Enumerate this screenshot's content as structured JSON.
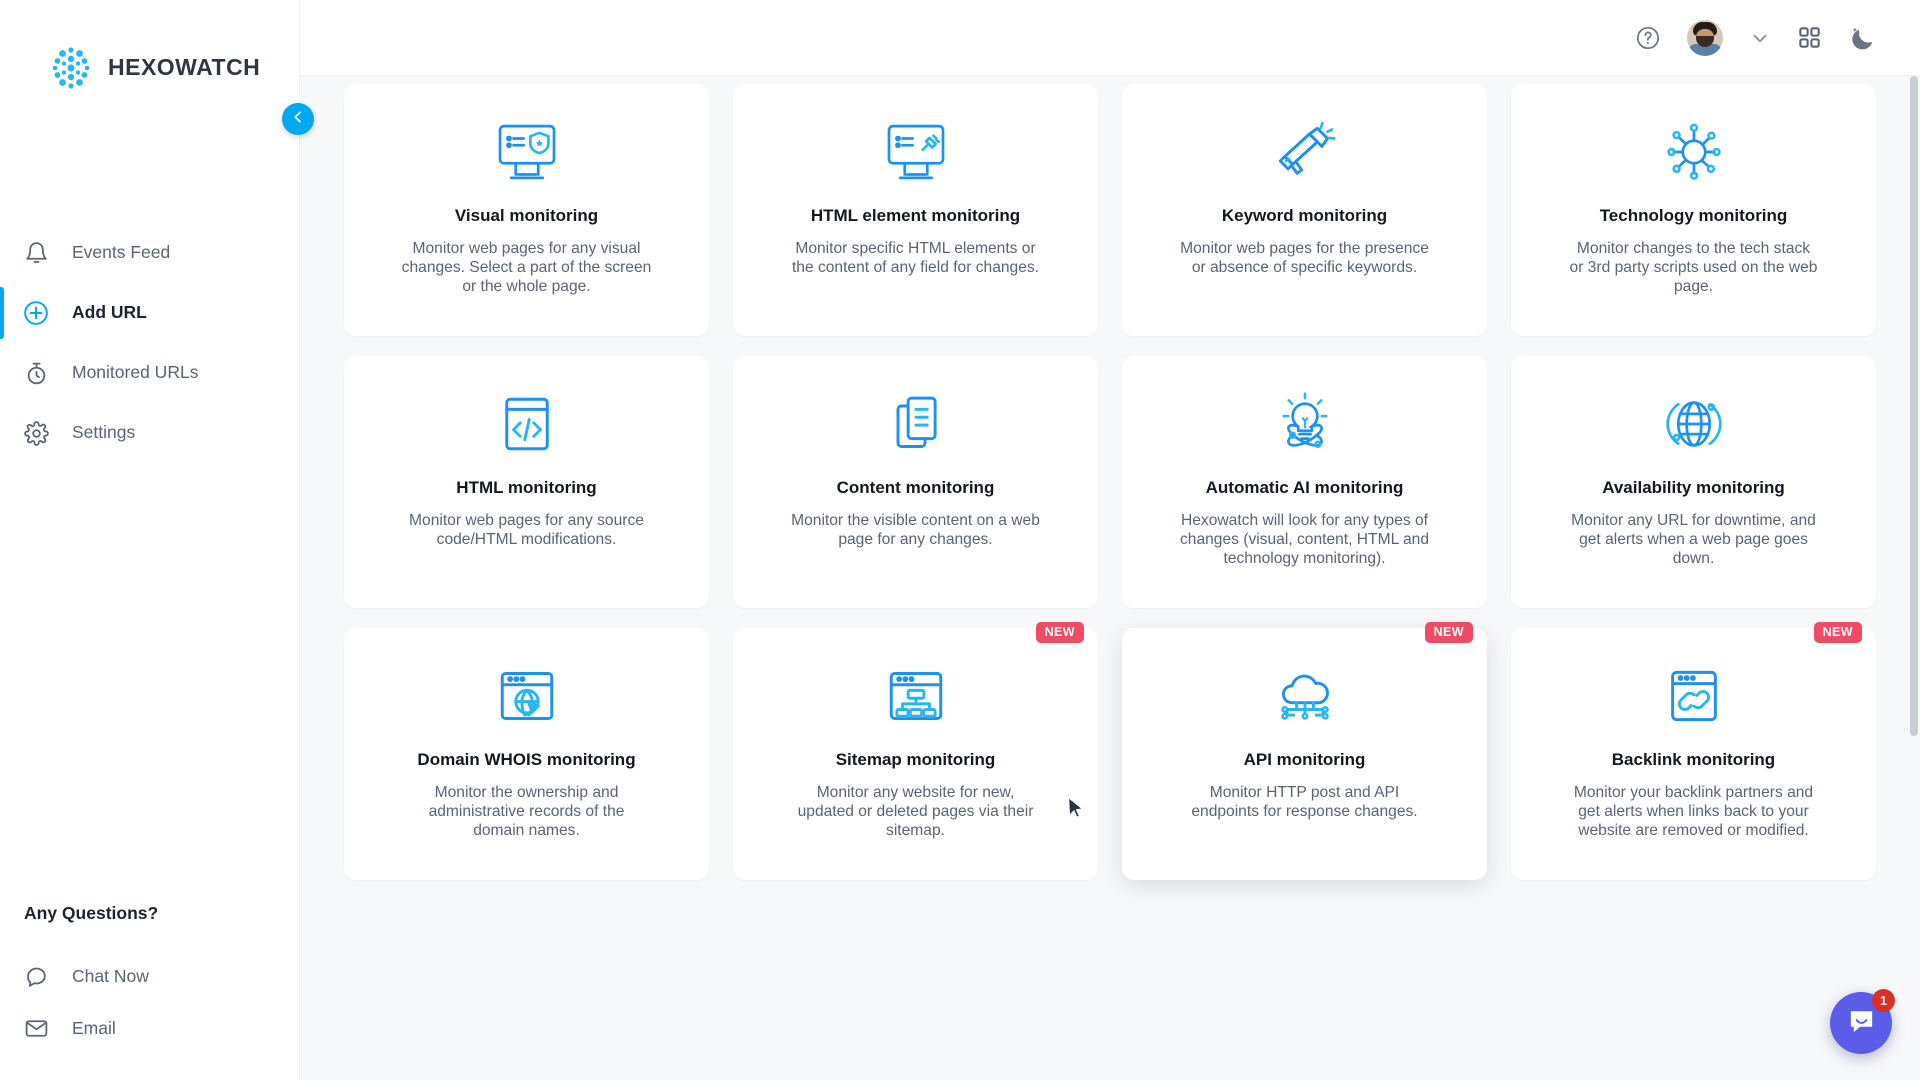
{
  "brand": {
    "name": "HEXOWATCH",
    "logo_icon": "hexowatch-dots-logo",
    "accent": "#00a8f0"
  },
  "sidebar": {
    "collapse_icon": "chevron-left-icon",
    "items": [
      {
        "label": "Events Feed",
        "icon": "bell-icon",
        "active": false
      },
      {
        "label": "Add URL",
        "icon": "plus-circle-icon",
        "active": true
      },
      {
        "label": "Monitored URLs",
        "icon": "stopwatch-icon",
        "active": false
      },
      {
        "label": "Settings",
        "icon": "gear-icon",
        "active": false
      }
    ],
    "help": {
      "title": "Any Questions?",
      "items": [
        {
          "label": "Chat Now",
          "icon": "chat-bubble-icon"
        },
        {
          "label": "Email",
          "icon": "envelope-icon"
        }
      ]
    }
  },
  "topbar": {
    "help_icon": "question-circle-icon",
    "avatar_icon": "user-avatar",
    "dropdown_icon": "chevron-down-icon",
    "apps_icon": "grid-apps-icon",
    "theme_icon": "moon-stars-icon"
  },
  "cards": [
    {
      "title": "Visual monitoring",
      "desc": "Monitor web pages for any visual changes. Select a part of the screen or the whole page.",
      "icon": "monitor-shield-icon",
      "badge": null,
      "hovered": false
    },
    {
      "title": "HTML element monitoring",
      "desc": "Monitor specific HTML elements or the content of any field for changes.",
      "icon": "monitor-pin-icon",
      "badge": null,
      "hovered": false
    },
    {
      "title": "Keyword monitoring",
      "desc": "Monitor web pages for the presence or absence of specific keywords.",
      "icon": "megaphone-icon",
      "badge": null,
      "hovered": false
    },
    {
      "title": "Technology monitoring",
      "desc": "Monitor changes to the tech stack or 3rd party scripts used on the web page.",
      "icon": "network-nodes-icon",
      "badge": null,
      "hovered": false
    },
    {
      "title": "HTML monitoring",
      "desc": "Monitor web pages for any source code/HTML modifications.",
      "icon": "code-window-icon",
      "badge": null,
      "hovered": false
    },
    {
      "title": "Content monitoring",
      "desc": "Monitor the visible content on a web page for any changes.",
      "icon": "documents-icon",
      "badge": null,
      "hovered": false
    },
    {
      "title": "Automatic AI monitoring",
      "desc": "Hexowatch will look for any types of changes (visual, content, HTML and technology monitoring).",
      "icon": "lightbulb-ai-icon",
      "badge": null,
      "hovered": false
    },
    {
      "title": "Availability monitoring",
      "desc": "Monitor any URL for downtime, and get alerts when a web page goes down.",
      "icon": "globe-arcs-icon",
      "badge": null,
      "hovered": false
    },
    {
      "title": "Domain WHOIS monitoring",
      "desc": "Monitor the ownership and administrative records of the domain names.",
      "icon": "browser-globe-icon",
      "badge": null,
      "hovered": false
    },
    {
      "title": "Sitemap monitoring",
      "desc": "Monitor any website for new, updated or deleted pages via their sitemap.",
      "icon": "browser-sitemap-icon",
      "badge": "NEW",
      "hovered": false
    },
    {
      "title": "API monitoring",
      "desc": "Monitor HTTP post and API endpoints for response changes.",
      "icon": "cloud-api-icon",
      "badge": "NEW",
      "hovered": true
    },
    {
      "title": "Backlink monitoring",
      "desc": "Monitor your backlink partners and get alerts when links back to your website are removed or modified.",
      "icon": "browser-link-icon",
      "badge": "NEW",
      "hovered": false
    }
  ],
  "chat_widget": {
    "icon": "intercom-messenger-icon",
    "unread_count": "1",
    "color": "#5b5ce8"
  }
}
